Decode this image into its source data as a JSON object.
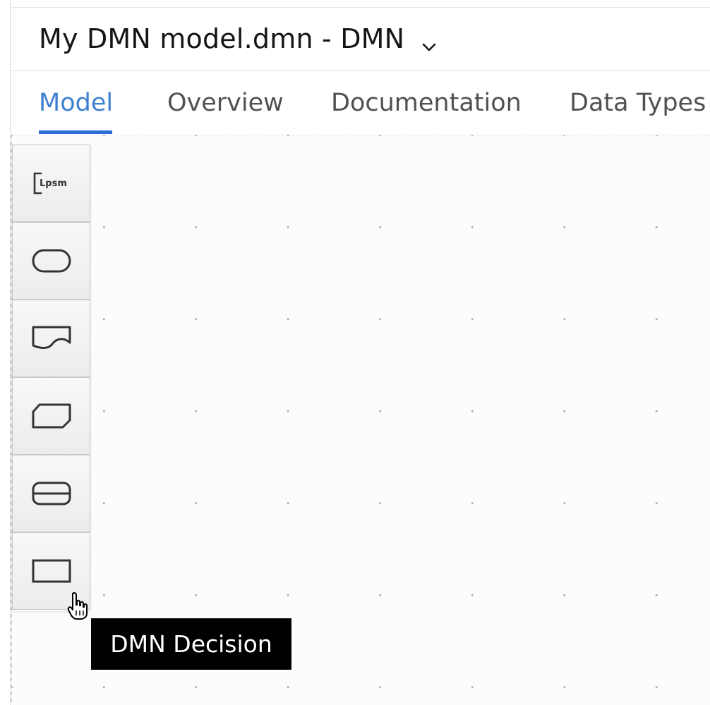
{
  "header": {
    "title": "My DMN model.dmn - DMN",
    "dropdown_icon": "chevron-down-icon"
  },
  "tabs": [
    {
      "label": "Model",
      "active": true
    },
    {
      "label": "Overview",
      "active": false
    },
    {
      "label": "Documentation",
      "active": false
    },
    {
      "label": "Data Types",
      "active": false
    }
  ],
  "palette": {
    "items": [
      {
        "icon": "text-annotation-icon"
      },
      {
        "icon": "input-data-icon"
      },
      {
        "icon": "knowledge-source-icon"
      },
      {
        "icon": "business-knowledge-model-icon"
      },
      {
        "icon": "decision-service-icon"
      },
      {
        "icon": "decision-icon"
      }
    ]
  },
  "tooltip": {
    "text": "DMN Decision"
  },
  "colors": {
    "accent": "#3f7fd0",
    "tab_underline": "#2b6fd6",
    "tooltip_bg": "#000000",
    "canvas_bg": "#fcfcfc"
  }
}
